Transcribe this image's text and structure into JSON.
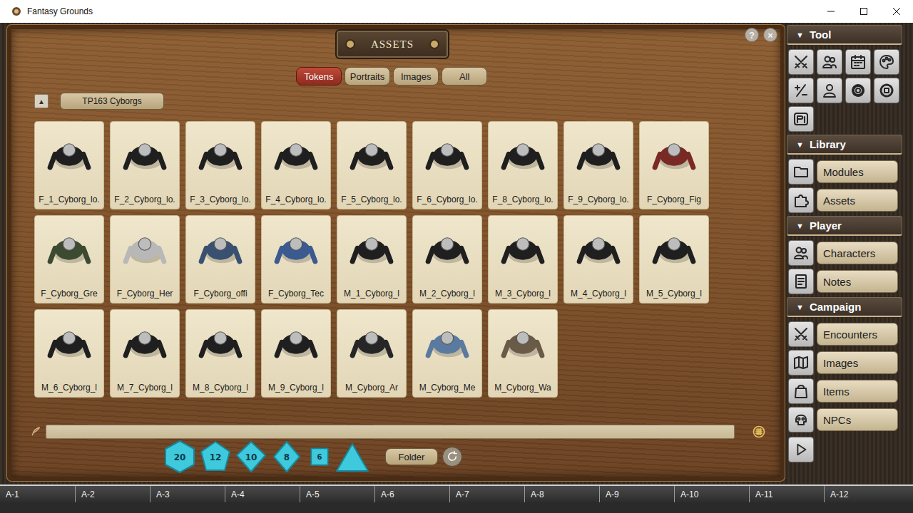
{
  "window": {
    "title": "Fantasy Grounds"
  },
  "assets": {
    "title": "ASSETS",
    "corner_buttons": [
      "?",
      "×"
    ],
    "tabs": [
      {
        "label": "Tokens",
        "selected": true
      },
      {
        "label": "Portraits",
        "selected": false
      },
      {
        "label": "Images",
        "selected": false
      },
      {
        "label": "All",
        "selected": false
      }
    ],
    "folder": {
      "up": "▲",
      "name": "TP163 Cyborgs"
    },
    "tokens": [
      {
        "label": "F_1_Cyborg_lo.",
        "color": "#1f1f1f"
      },
      {
        "label": "F_2_Cyborg_lo.",
        "color": "#1f1f1f"
      },
      {
        "label": "F_3_Cyborg_lo.",
        "color": "#1f1f1f"
      },
      {
        "label": "F_4_Cyborg_lo.",
        "color": "#1f1f1f"
      },
      {
        "label": "F_5_Cyborg_lo.",
        "color": "#1f1f1f"
      },
      {
        "label": "F_6_Cyborg_lo.",
        "color": "#1f1f1f"
      },
      {
        "label": "F_8_Cyborg_lo.",
        "color": "#1f1f1f"
      },
      {
        "label": "F_9_Cyborg_lo.",
        "color": "#1f1f1f"
      },
      {
        "label": "F_Cyborg_Fig",
        "color": "#7a2a24"
      },
      {
        "label": "F_Cyborg_Gre",
        "color": "#3b4a30"
      },
      {
        "label": "F_Cyborg_Her",
        "color": "#b8b8b8"
      },
      {
        "label": "F_Cyborg_offi",
        "color": "#3a5070"
      },
      {
        "label": "F_Cyborg_Tec",
        "color": "#3a5a90"
      },
      {
        "label": "M_1_Cyborg_l",
        "color": "#1f1f1f"
      },
      {
        "label": "M_2_Cyborg_l",
        "color": "#1f1f1f"
      },
      {
        "label": "M_3_Cyborg_l",
        "color": "#1f1f1f"
      },
      {
        "label": "M_4_Cyborg_l",
        "color": "#1f1f1f"
      },
      {
        "label": "M_5_Cyborg_l",
        "color": "#1f1f1f"
      },
      {
        "label": "M_6_Cyborg_l",
        "color": "#1f1f1f"
      },
      {
        "label": "M_7_Cyborg_l",
        "color": "#1f1f1f"
      },
      {
        "label": "M_8_Cyborg_l",
        "color": "#1f1f1f"
      },
      {
        "label": "M_9_Cyborg_l",
        "color": "#1f1f1f"
      },
      {
        "label": "M_Cyborg_Ar",
        "color": "#262626"
      },
      {
        "label": "M_Cyborg_Me",
        "color": "#5a7aa0"
      },
      {
        "label": "M_Cyborg_Wa",
        "color": "#6a5a48"
      }
    ],
    "chat": {
      "value": ""
    },
    "dice": [
      {
        "kind": "d20",
        "label": "20"
      },
      {
        "kind": "d12",
        "label": "12"
      },
      {
        "kind": "d10",
        "label": "10"
      },
      {
        "kind": "d8",
        "label": "8"
      },
      {
        "kind": "d6",
        "label": "6"
      },
      {
        "kind": "d4"
      }
    ],
    "folder_button": "Folder"
  },
  "sidebar": {
    "sections": [
      {
        "title": "Tool",
        "toggle": "▼",
        "expanded": true,
        "kind": "icons"
      },
      {
        "title": "Library",
        "toggle": "▼",
        "expanded": true,
        "kind": "list",
        "items": [
          "Modules",
          "Assets"
        ]
      },
      {
        "title": "Player",
        "toggle": "▼",
        "expanded": true,
        "kind": "list",
        "items": [
          "Characters",
          "Notes"
        ]
      },
      {
        "title": "Campaign",
        "toggle": "▼",
        "expanded": true,
        "kind": "list",
        "items": [
          "Encounters",
          "Images",
          "Items",
          "NPCs"
        ]
      }
    ]
  },
  "hotkeys": [
    "A-1",
    "A-2",
    "A-3",
    "A-4",
    "A-5",
    "A-6",
    "A-7",
    "A-8",
    "A-9",
    "A-10",
    "A-11",
    "A-12"
  ]
}
